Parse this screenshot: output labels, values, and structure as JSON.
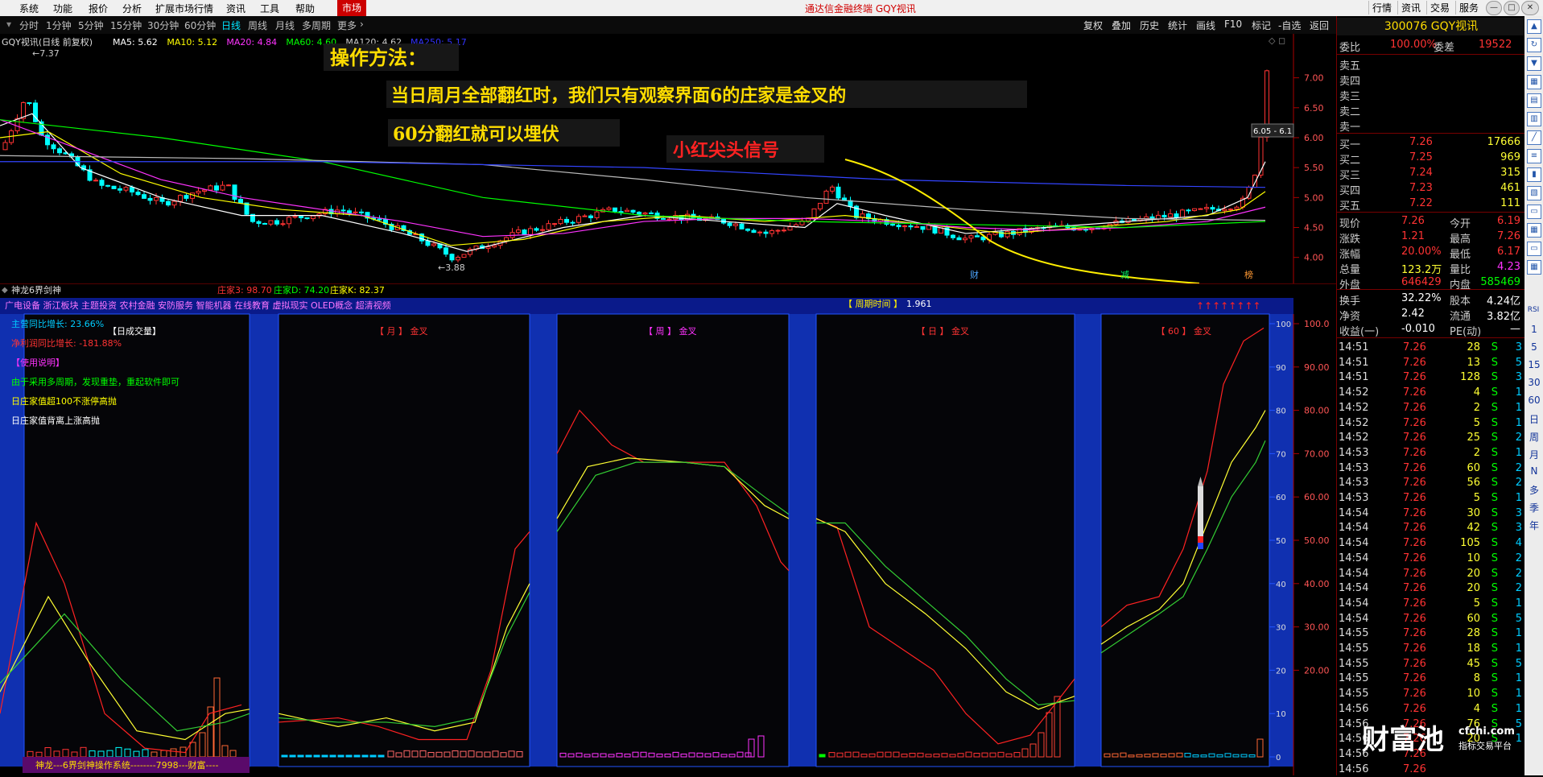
{
  "menubar": {
    "items": [
      "系统",
      "功能",
      "报价",
      "分析",
      "扩展市场行情",
      "资讯",
      "工具",
      "帮助"
    ],
    "market": "市场",
    "title": "通达信金融终端 GQY视讯",
    "right": [
      "行情",
      "资讯",
      "交易",
      "服务"
    ]
  },
  "periodbar": {
    "items": [
      "分时",
      "1分钟",
      "5分钟",
      "15分钟",
      "30分钟",
      "60分钟",
      "日线",
      "周线",
      "月线",
      "多周期",
      "更多"
    ],
    "selected": "日线",
    "right": [
      "复权",
      "叠加",
      "历史",
      "统计",
      "画线",
      "F10",
      "标记",
      "-自选",
      "返回"
    ]
  },
  "kchart": {
    "header_name": "GQY视讯(日线 前复权)",
    "ma": [
      {
        "label": "MA5: 5.62",
        "color": "#ffffff"
      },
      {
        "label": "MA10: 5.12",
        "color": "#ffff00"
      },
      {
        "label": "MA20: 4.84",
        "color": "#ff33ff"
      },
      {
        "label": "MA60: 4.60",
        "color": "#00ff00"
      },
      {
        "label": "MA120: 4.62",
        "color": "#cccccc"
      },
      {
        "label": "MA250: 5.17",
        "color": "#3333ff"
      }
    ],
    "high_label": "7.37",
    "low_label": "3.88",
    "price_tag": "6.05 - 6.1",
    "yticks": [
      "7.00",
      "6.50",
      "6.00",
      "5.50",
      "5.00",
      "4.50",
      "4.00"
    ],
    "annotations": {
      "line1": "操作方法：",
      "line2": "当日周月全部翻红时，我们只有观察界面6的庄家是金叉的",
      "line3": "60分翻红就可以埋伏",
      "line4": "小红尖头信号"
    },
    "markers": [
      "财",
      "减",
      "榜"
    ]
  },
  "indicator": {
    "name": "神龙6界剑神",
    "values": [
      {
        "label": "庄家3: 98.70",
        "color": "#ff3333"
      },
      {
        "label": "庄家D: 74.20",
        "color": "#00ff00"
      },
      {
        "label": "庄家K: 82.37",
        "color": "#ffff00"
      }
    ],
    "concepts": "广电设备 浙江板块 主题投资 农村金融 安防服务 智能机器 在线教育 虚拟现实 OLED概念 超清视频",
    "cycle_label": "【 周期时间 】",
    "cycle_value": "1.961",
    "panels": [
      {
        "title": "【日成交量】",
        "color": "#ffffff"
      },
      {
        "title": "【 月 】 金叉",
        "color": "#ff3333"
      },
      {
        "title": "【 周 】 金叉",
        "color": "#ff33ff"
      },
      {
        "title": "【 日 】 金叉",
        "color": "#ff3333"
      },
      {
        "title": "【 60 】 金叉",
        "color": "#ff3333"
      }
    ],
    "info": [
      {
        "text": "主营同比增长: 23.66%",
        "color": "#00ccff"
      },
      {
        "text": "净利润同比增长: -181.88%",
        "color": "#ff3333"
      },
      {
        "text": "【使用说明】",
        "color": "#ff33ff"
      },
      {
        "text": "由于采用多周期，发现重垫，重起软件即可",
        "color": "#00ff00"
      },
      {
        "text": "日庄家值超100不涨停高抛",
        "color": "#ffff00"
      },
      {
        "text": "日庄家值背离上涨高抛",
        "color": "#ffffff"
      }
    ],
    "footer": "神龙---6界剑神操作系统--------7998---财富----",
    "yticks_inner": [
      "100",
      "90",
      "80",
      "70",
      "60",
      "50",
      "40",
      "30",
      "20",
      "10",
      "0"
    ],
    "yticks_outer": [
      "100.0",
      "90.00",
      "80.00",
      "70.00",
      "60.00",
      "50.00",
      "40.00",
      "30.00",
      "20.00"
    ]
  },
  "quote": {
    "code_name": "300076 GQY视讯",
    "weibi": {
      "l1": "委比",
      "v1": "100.00%",
      "l2": "委差",
      "v2": "19522"
    },
    "sell": [
      {
        "label": "卖五"
      },
      {
        "label": "卖四"
      },
      {
        "label": "卖三"
      },
      {
        "label": "卖二"
      },
      {
        "label": "卖一"
      }
    ],
    "buy": [
      {
        "label": "买一",
        "price": "7.26",
        "vol": "17666"
      },
      {
        "label": "买二",
        "price": "7.25",
        "vol": "969"
      },
      {
        "label": "买三",
        "price": "7.24",
        "vol": "315"
      },
      {
        "label": "买四",
        "price": "7.23",
        "vol": "461"
      },
      {
        "label": "买五",
        "price": "7.22",
        "vol": "111"
      }
    ],
    "stats": [
      {
        "l1": "现价",
        "v1": "7.26",
        "l2": "今开",
        "v2": "6.19"
      },
      {
        "l1": "涨跌",
        "v1": "1.21",
        "l2": "最高",
        "v2": "7.26"
      },
      {
        "l1": "涨幅",
        "v1": "20.00%",
        "l2": "最低",
        "v2": "6.17"
      },
      {
        "l1": "总量",
        "v1": "123.2万",
        "l2": "量比",
        "v2": "4.23"
      },
      {
        "l1": "外盘",
        "v1": "646429",
        "l2": "内盘",
        "v2": "585469"
      }
    ],
    "stats2": [
      {
        "l1": "换手",
        "v1": "32.22%",
        "l2": "股本",
        "v2": "4.24亿"
      },
      {
        "l1": "净资",
        "v1": "2.42",
        "l2": "流通",
        "v2": "3.82亿"
      },
      {
        "l1": "收益(一)",
        "v1": "-0.010",
        "l2": "PE(动)",
        "v2": "—"
      }
    ],
    "ticks": [
      [
        "14:51",
        "7.26",
        "28",
        "S",
        "3"
      ],
      [
        "14:51",
        "7.26",
        "13",
        "S",
        "5"
      ],
      [
        "14:51",
        "7.26",
        "128",
        "S",
        "3"
      ],
      [
        "14:52",
        "7.26",
        "4",
        "S",
        "1"
      ],
      [
        "14:52",
        "7.26",
        "2",
        "S",
        "1"
      ],
      [
        "14:52",
        "7.26",
        "5",
        "S",
        "1"
      ],
      [
        "14:52",
        "7.26",
        "25",
        "S",
        "2"
      ],
      [
        "14:53",
        "7.26",
        "2",
        "S",
        "1"
      ],
      [
        "14:53",
        "7.26",
        "60",
        "S",
        "2"
      ],
      [
        "14:53",
        "7.26",
        "56",
        "S",
        "2"
      ],
      [
        "14:53",
        "7.26",
        "5",
        "S",
        "1"
      ],
      [
        "14:54",
        "7.26",
        "30",
        "S",
        "3"
      ],
      [
        "14:54",
        "7.26",
        "42",
        "S",
        "3"
      ],
      [
        "14:54",
        "7.26",
        "105",
        "S",
        "4"
      ],
      [
        "14:54",
        "7.26",
        "10",
        "S",
        "2"
      ],
      [
        "14:54",
        "7.26",
        "20",
        "S",
        "2"
      ],
      [
        "14:54",
        "7.26",
        "20",
        "S",
        "2"
      ],
      [
        "14:54",
        "7.26",
        "5",
        "S",
        "1"
      ],
      [
        "14:54",
        "7.26",
        "60",
        "S",
        "5"
      ],
      [
        "14:55",
        "7.26",
        "28",
        "S",
        "1"
      ],
      [
        "14:55",
        "7.26",
        "18",
        "S",
        "1"
      ],
      [
        "14:55",
        "7.26",
        "45",
        "S",
        "5"
      ],
      [
        "14:55",
        "7.26",
        "8",
        "S",
        "1"
      ],
      [
        "14:55",
        "7.26",
        "10",
        "S",
        "1"
      ],
      [
        "14:56",
        "7.26",
        "4",
        "S",
        "1"
      ],
      [
        "14:56",
        "7.26",
        "76",
        "S",
        "5"
      ],
      [
        "14:56",
        "7.26",
        "20",
        "S",
        "1"
      ],
      [
        "14:56",
        "7.26",
        "",
        "",
        " "
      ],
      [
        "14:56",
        "7.26",
        "",
        "",
        " "
      ]
    ]
  },
  "sidebar": {
    "icons": [
      "up-icon",
      "refresh-icon",
      "down-icon",
      "chart-icon",
      "bar-icon",
      "grid-icon",
      "line-icon",
      "list-icon",
      "k-icon",
      "stack-icon",
      "doc-icon",
      "table-icon",
      "doc2-icon",
      "table2-icon"
    ],
    "labels": [
      "RSI",
      "1",
      "5",
      "15",
      "30",
      "60",
      "日",
      "周",
      "月",
      "N",
      "多",
      "季",
      "年"
    ]
  },
  "watermark": {
    "main": "财富池",
    "site": "cfchi.com",
    "sub": "指标交易平台"
  }
}
